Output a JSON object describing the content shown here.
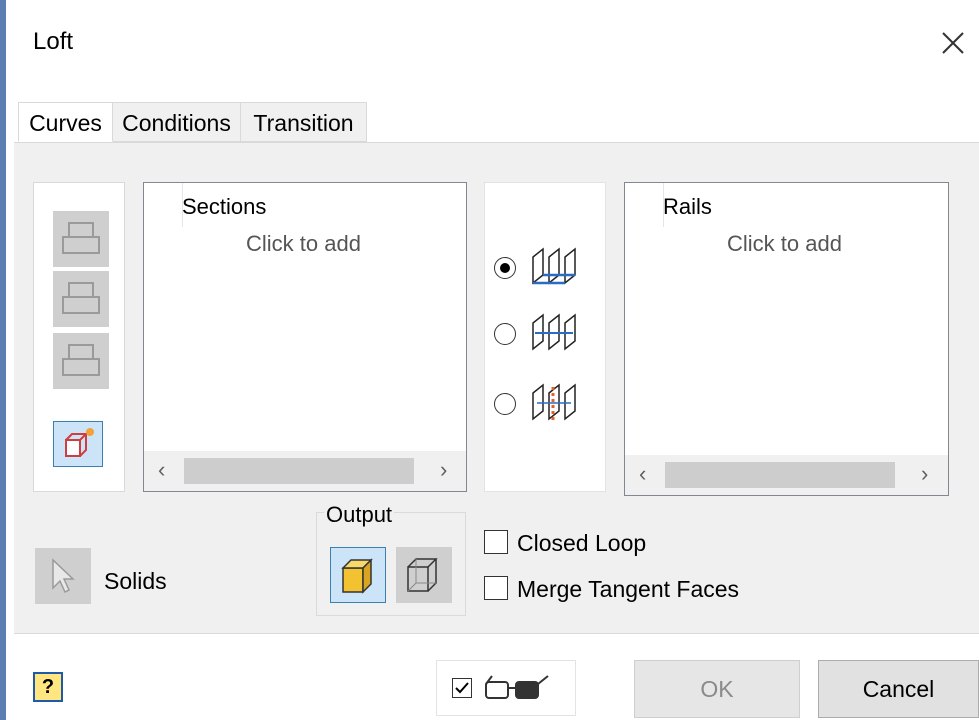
{
  "window": {
    "title": "Loft",
    "close_icon": "close-icon"
  },
  "tabs": [
    {
      "label": "Curves",
      "active": true
    },
    {
      "label": "Conditions",
      "active": false
    },
    {
      "label": "Transition",
      "active": false
    }
  ],
  "toolbar": {
    "items": [
      {
        "icon": "move-up-icon",
        "enabled": false
      },
      {
        "icon": "move-middle-icon",
        "enabled": false
      },
      {
        "icon": "move-down-icon",
        "enabled": false
      },
      {
        "icon": "add-section-icon",
        "enabled": true
      }
    ]
  },
  "sections": {
    "header": "Sections",
    "placeholder": "Click to add"
  },
  "rails": {
    "header": "Rails",
    "placeholder": "Click to add"
  },
  "loft_mode": {
    "options": [
      {
        "icon": "rails-mode-icon",
        "selected": true
      },
      {
        "icon": "centerline-mode-icon",
        "selected": false
      },
      {
        "icon": "area-loft-mode-icon",
        "selected": false
      }
    ]
  },
  "solids": {
    "label": "Solids",
    "icon": "select-cursor-icon"
  },
  "output": {
    "label": "Output",
    "options": [
      {
        "icon": "solid-output-icon",
        "selected": true
      },
      {
        "icon": "surface-output-icon",
        "selected": false
      }
    ]
  },
  "options": {
    "closed_loop": {
      "label": "Closed Loop",
      "checked": false
    },
    "merge_tangent_faces": {
      "label": "Merge Tangent Faces",
      "checked": false
    }
  },
  "footer": {
    "help_label": "?",
    "preview_checked": true,
    "ok_label": "OK",
    "cancel_label": "Cancel"
  },
  "colors": {
    "accent": "#3c7fb1",
    "selected_bg": "#cce4f7",
    "panel_bg": "#f0f0f0"
  }
}
